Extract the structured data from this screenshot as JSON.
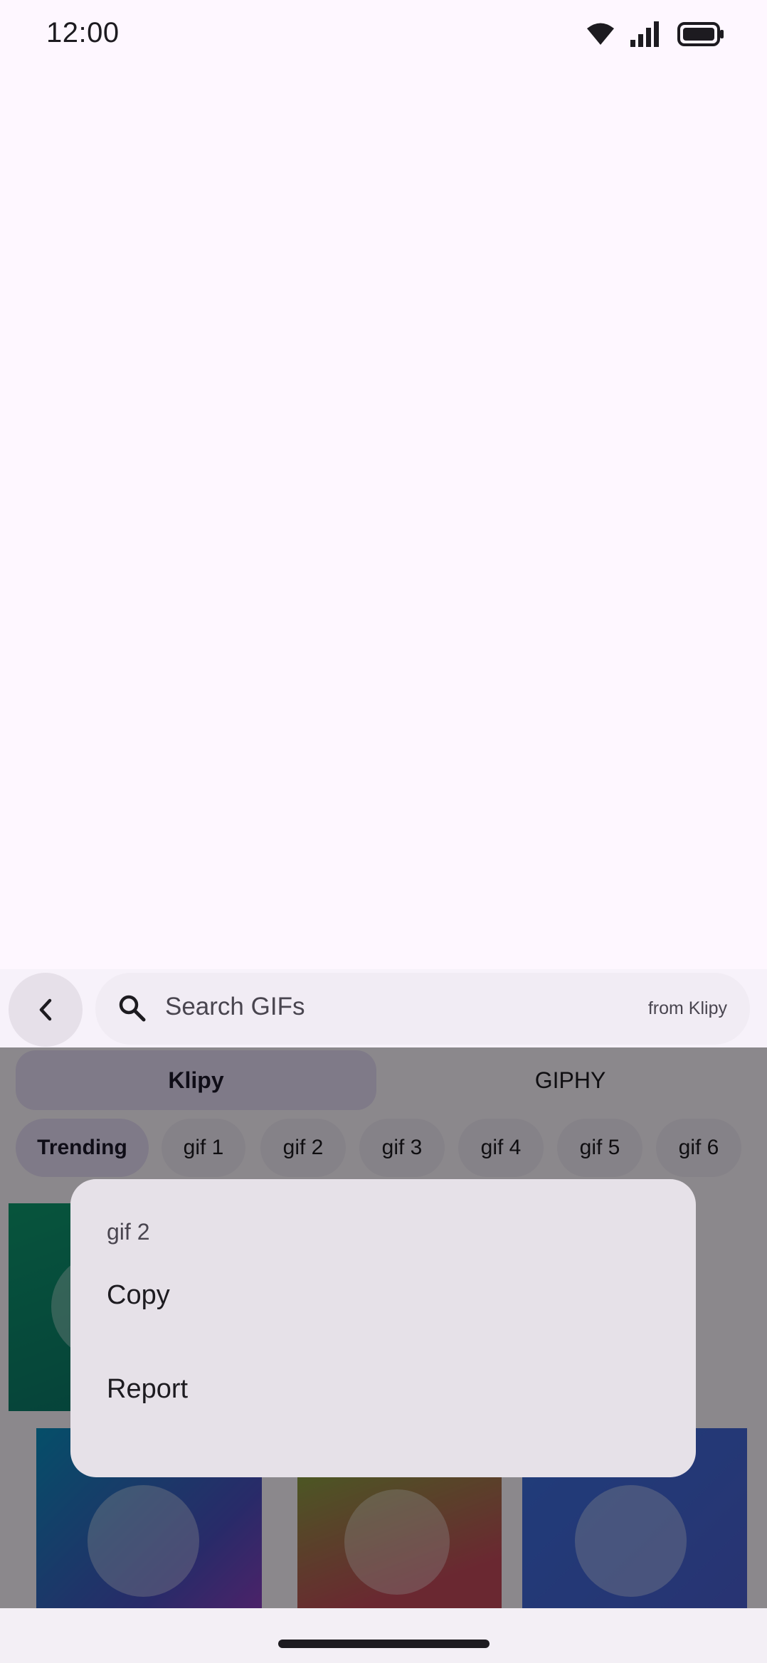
{
  "status_bar": {
    "time": "12:00",
    "icons": [
      "wifi-icon",
      "signal-icon",
      "battery-icon"
    ]
  },
  "search": {
    "placeholder": "Search GIFs",
    "source": "from Klipy"
  },
  "providers": [
    {
      "label": "Klipy",
      "active": true
    },
    {
      "label": "GIPHY",
      "active": false
    }
  ],
  "categories": [
    {
      "label": "Trending",
      "active": true
    },
    {
      "label": "gif 1"
    },
    {
      "label": "gif 2"
    },
    {
      "label": "gif 3"
    },
    {
      "label": "gif 4"
    },
    {
      "label": "gif 5"
    },
    {
      "label": "gif 6"
    }
  ],
  "context_menu": {
    "title": "gif 2",
    "items": [
      "Copy",
      "Report"
    ]
  },
  "colors": {
    "background": "#fef7ff",
    "accent_container": "#e8def8",
    "scrim": "rgba(0,0,0,0.45)"
  }
}
